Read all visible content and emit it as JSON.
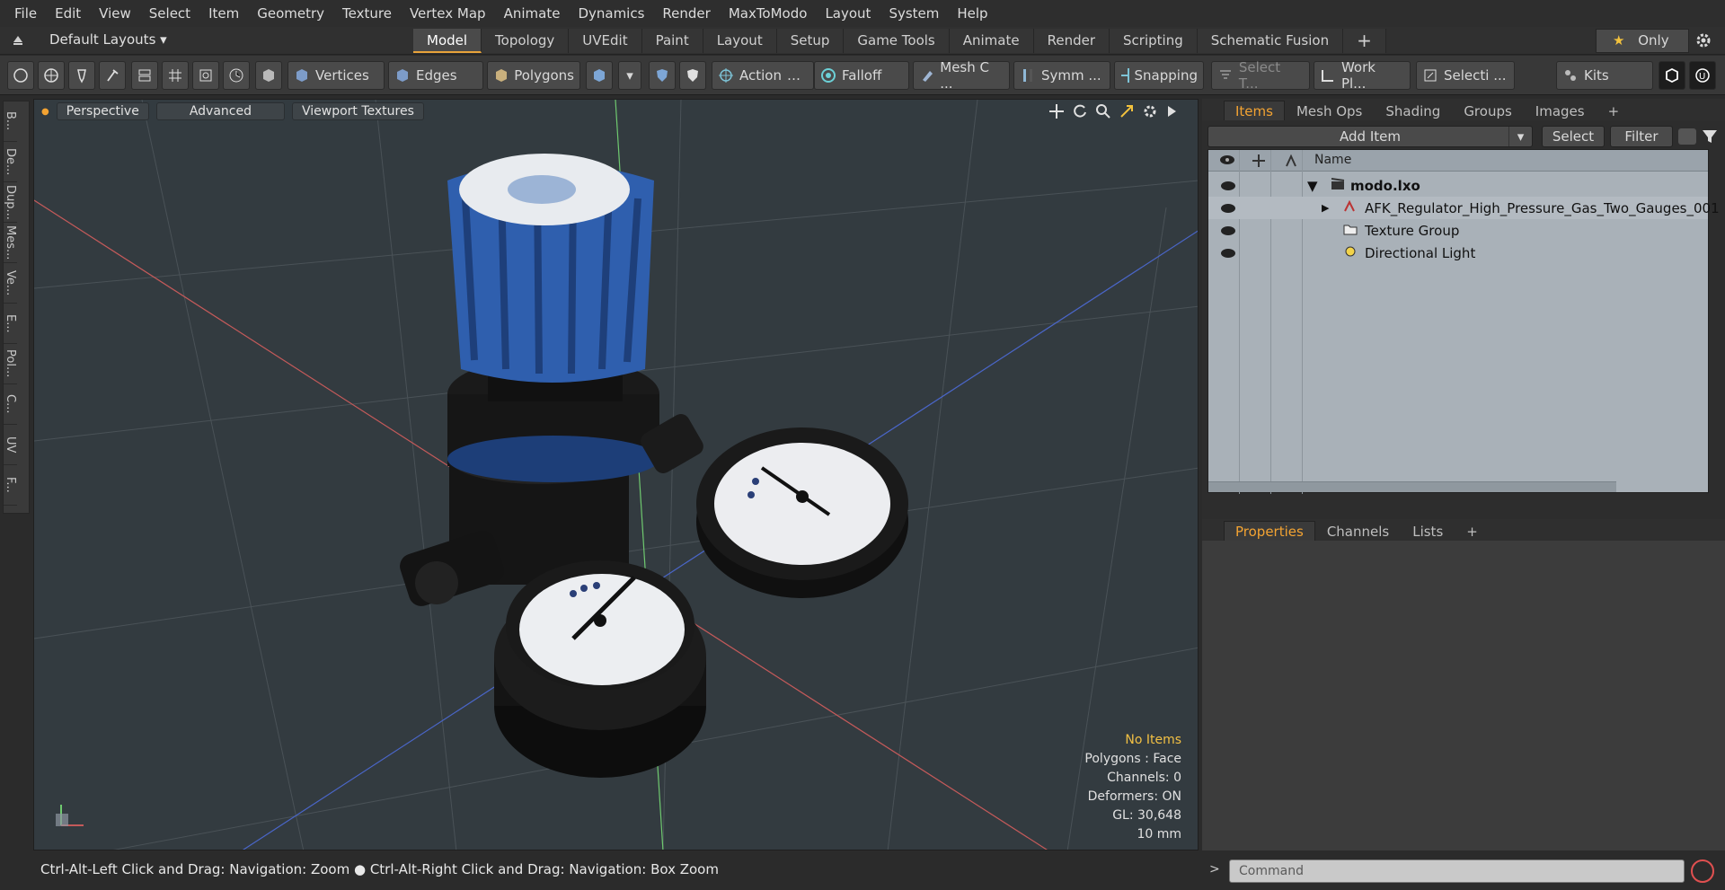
{
  "menu": [
    "File",
    "Edit",
    "View",
    "Select",
    "Item",
    "Geometry",
    "Texture",
    "Vertex Map",
    "Animate",
    "Dynamics",
    "Render",
    "MaxToModo",
    "Layout",
    "System",
    "Help"
  ],
  "layout_selector": "Default Layouts",
  "layout_tabs": [
    "Model",
    "Topology",
    "UVEdit",
    "Paint",
    "Layout",
    "Setup",
    "Game Tools",
    "Animate",
    "Render",
    "Scripting",
    "Schematic Fusion"
  ],
  "layout_active": "Model",
  "only_label": "Only",
  "toolbar": {
    "vertices": "Vertices",
    "edges": "Edges",
    "polygons": "Polygons",
    "action": "Action",
    "falloff": "Falloff",
    "mesh_c": "Mesh C ...",
    "symm": "Symm ...",
    "snapping": "Snapping",
    "select_t": "Select T...",
    "work_pl": "Work Pl...",
    "selecti": "Selecti ...",
    "kits": "Kits"
  },
  "side_tabs": [
    "B...",
    "De...",
    "Dup...",
    "Mes...",
    "Ve...",
    "E...",
    "Pol...",
    "C...",
    "UV",
    "F..."
  ],
  "viewport": {
    "perspective": "Perspective",
    "advanced": "Advanced",
    "viewport_textures": "Viewport Textures",
    "info": {
      "no_items": "No Items",
      "polygons": "Polygons : Face",
      "channels": "Channels: 0",
      "deformers": "Deformers: ON",
      "gl": "GL: 30,648",
      "unit": "10 mm"
    }
  },
  "items_panel": {
    "tabs": [
      "Items",
      "Mesh Ops",
      "Shading",
      "Groups",
      "Images"
    ],
    "active_tab": "Items",
    "add_item": "Add Item",
    "select": "Select",
    "filter": "Filter",
    "col_name": "Name",
    "tree": [
      {
        "label": "modo.lxo"
      },
      {
        "label": "AFK_Regulator_High_Pressure_Gas_Two_Gauges_001"
      },
      {
        "label": "Texture Group"
      },
      {
        "label": "Directional Light"
      }
    ]
  },
  "props_panel": {
    "tabs": [
      "Properties",
      "Channels",
      "Lists"
    ],
    "active_tab": "Properties"
  },
  "status_text": "Ctrl-Alt-Left Click and Drag: Navigation: Zoom ● Ctrl-Alt-Right Click and Drag: Navigation: Box Zoom",
  "command_placeholder": "Command",
  "colors": {
    "accent": "#f3a332",
    "viewport_bg": "#333b40",
    "knob_blue": "#2f5fae"
  }
}
